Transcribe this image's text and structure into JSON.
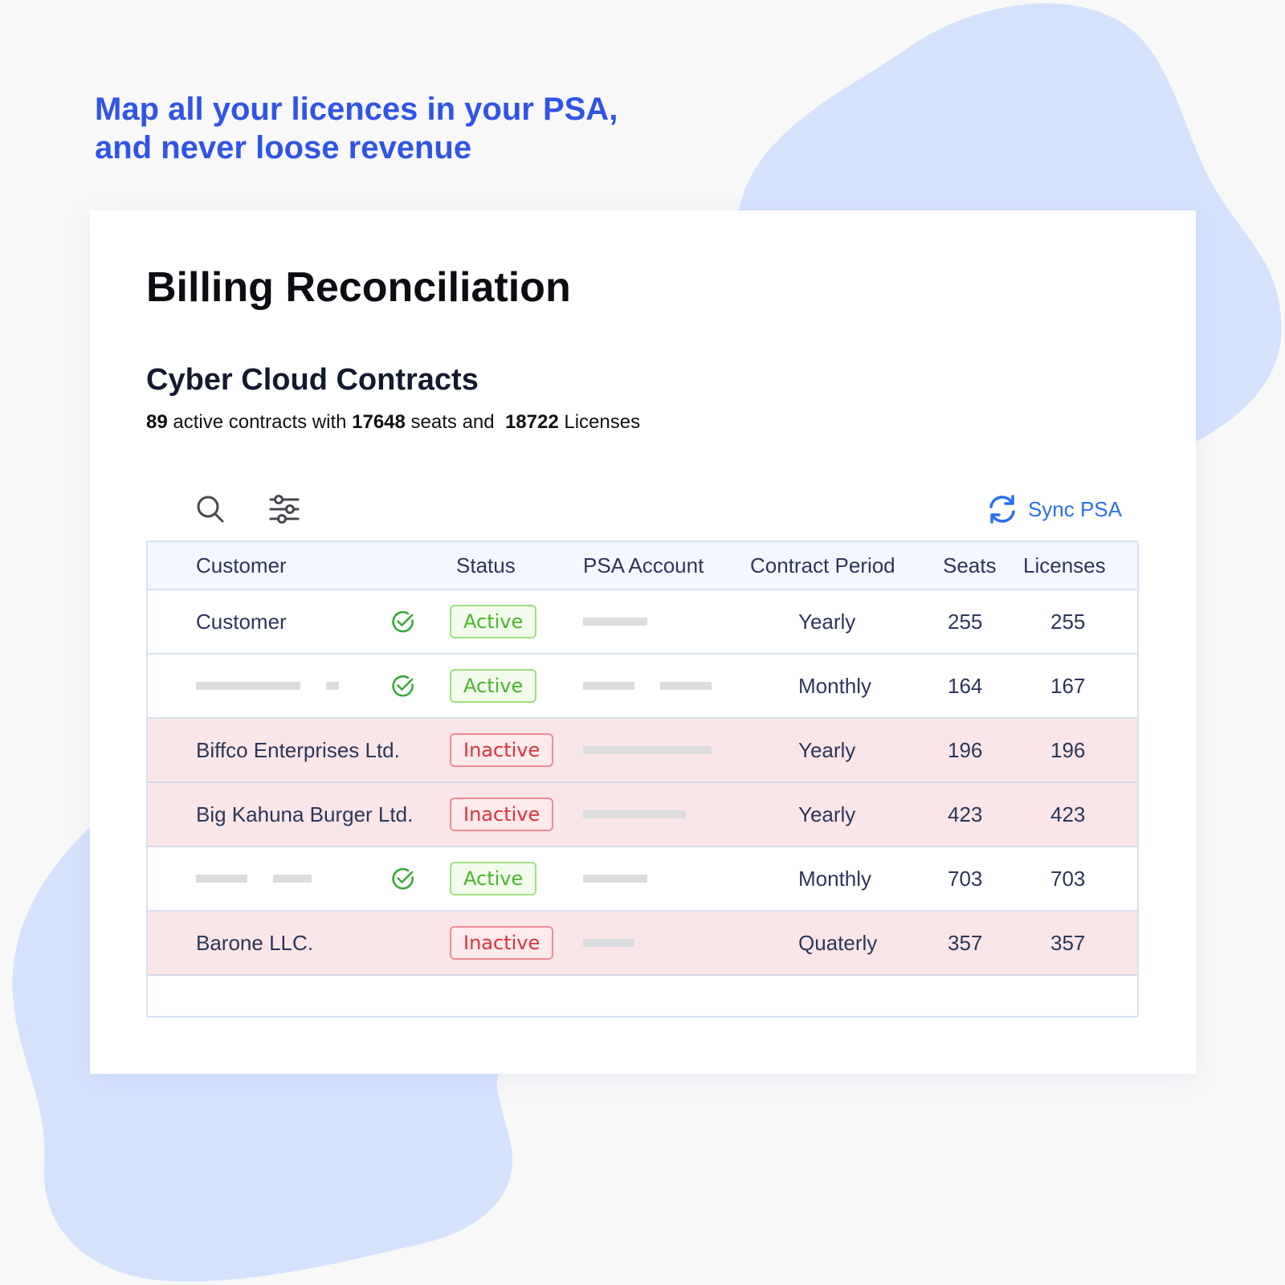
{
  "tagline": {
    "line1": "Map all your licences in your PSA,",
    "line2": "and never loose revenue"
  },
  "page": {
    "title": "Billing Reconciliation",
    "section_title": "Cyber Cloud Contracts",
    "summary": {
      "contracts": "89",
      "text1": " active contracts with ",
      "seats": "17648",
      "text2": " seats and  ",
      "licenses": "18722",
      "text3": " Licenses"
    }
  },
  "toolbar": {
    "search_icon": "search-icon",
    "filter_icon": "sliders-icon",
    "sync_label": "Sync PSA",
    "sync_icon": "refresh-icon"
  },
  "colors": {
    "accent": "#2f55e6",
    "link": "#2a6ef0",
    "active": "#48b52a",
    "inactive": "#e0303e",
    "inactive_row": "#fae6e8",
    "blob": "#d5e2fd"
  },
  "table": {
    "columns": [
      "Customer",
      "Status",
      "PSA Account",
      "Contract Period",
      "Seats",
      "Licenses"
    ],
    "rows": [
      {
        "customer": "Customer",
        "check": true,
        "status": "Active",
        "period": "Yearly",
        "seats": "255",
        "licenses": "255"
      },
      {
        "customer": "",
        "check": true,
        "status": "Active",
        "period": "Monthly",
        "seats": "164",
        "licenses": "167"
      },
      {
        "customer": "Biffco Enterprises Ltd.",
        "check": false,
        "status": "Inactive",
        "period": "Yearly",
        "seats": "196",
        "licenses": "196"
      },
      {
        "customer": "Big Kahuna Burger Ltd.",
        "check": false,
        "status": "Inactive",
        "period": "Yearly",
        "seats": "423",
        "licenses": "423"
      },
      {
        "customer": "",
        "check": true,
        "status": "Active",
        "period": "Monthly",
        "seats": "703",
        "licenses": "703"
      },
      {
        "customer": "Barone LLC.",
        "check": false,
        "status": "Inactive",
        "period": "Quaterly",
        "seats": "357",
        "licenses": "357"
      }
    ]
  }
}
